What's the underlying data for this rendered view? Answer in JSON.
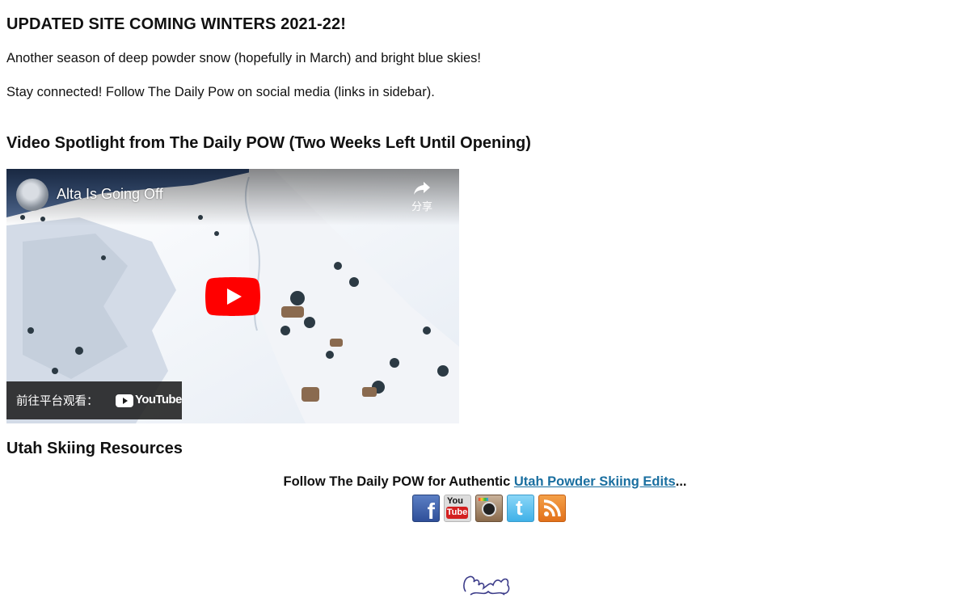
{
  "header": {
    "title": "UPDATED SITE COMING WINTERS 2021-22!"
  },
  "intro": {
    "line1": "Another season of deep powder snow (hopefully in March) and bright blue skies!",
    "line2": "Stay connected! Follow The Daily Pow on social media (links in sidebar)."
  },
  "video_section": {
    "heading": "Video Spotlight from The Daily POW (Two Weeks Left Until Opening)",
    "video": {
      "title": "Alta Is Going Off",
      "share_label": "分享",
      "watch_label": "前往平台观看：",
      "platform_label": "YouTube",
      "play_color": "#ff0000"
    }
  },
  "resources": {
    "heading": "Utah Skiing Resources",
    "follow_prefix": "Follow The Daily POW for Authentic ",
    "follow_link": "Utah Powder Skiing Edits",
    "follow_suffix": "...",
    "social": [
      {
        "name": "facebook-icon",
        "label": "f"
      },
      {
        "name": "youtube-icon",
        "label_top": "You",
        "label_bottom": "Tube"
      },
      {
        "name": "instagram-icon"
      },
      {
        "name": "twitter-icon",
        "label": "t"
      },
      {
        "name": "rss-icon"
      }
    ]
  },
  "colors": {
    "link": "#1a6fa0",
    "text": "#111111"
  }
}
